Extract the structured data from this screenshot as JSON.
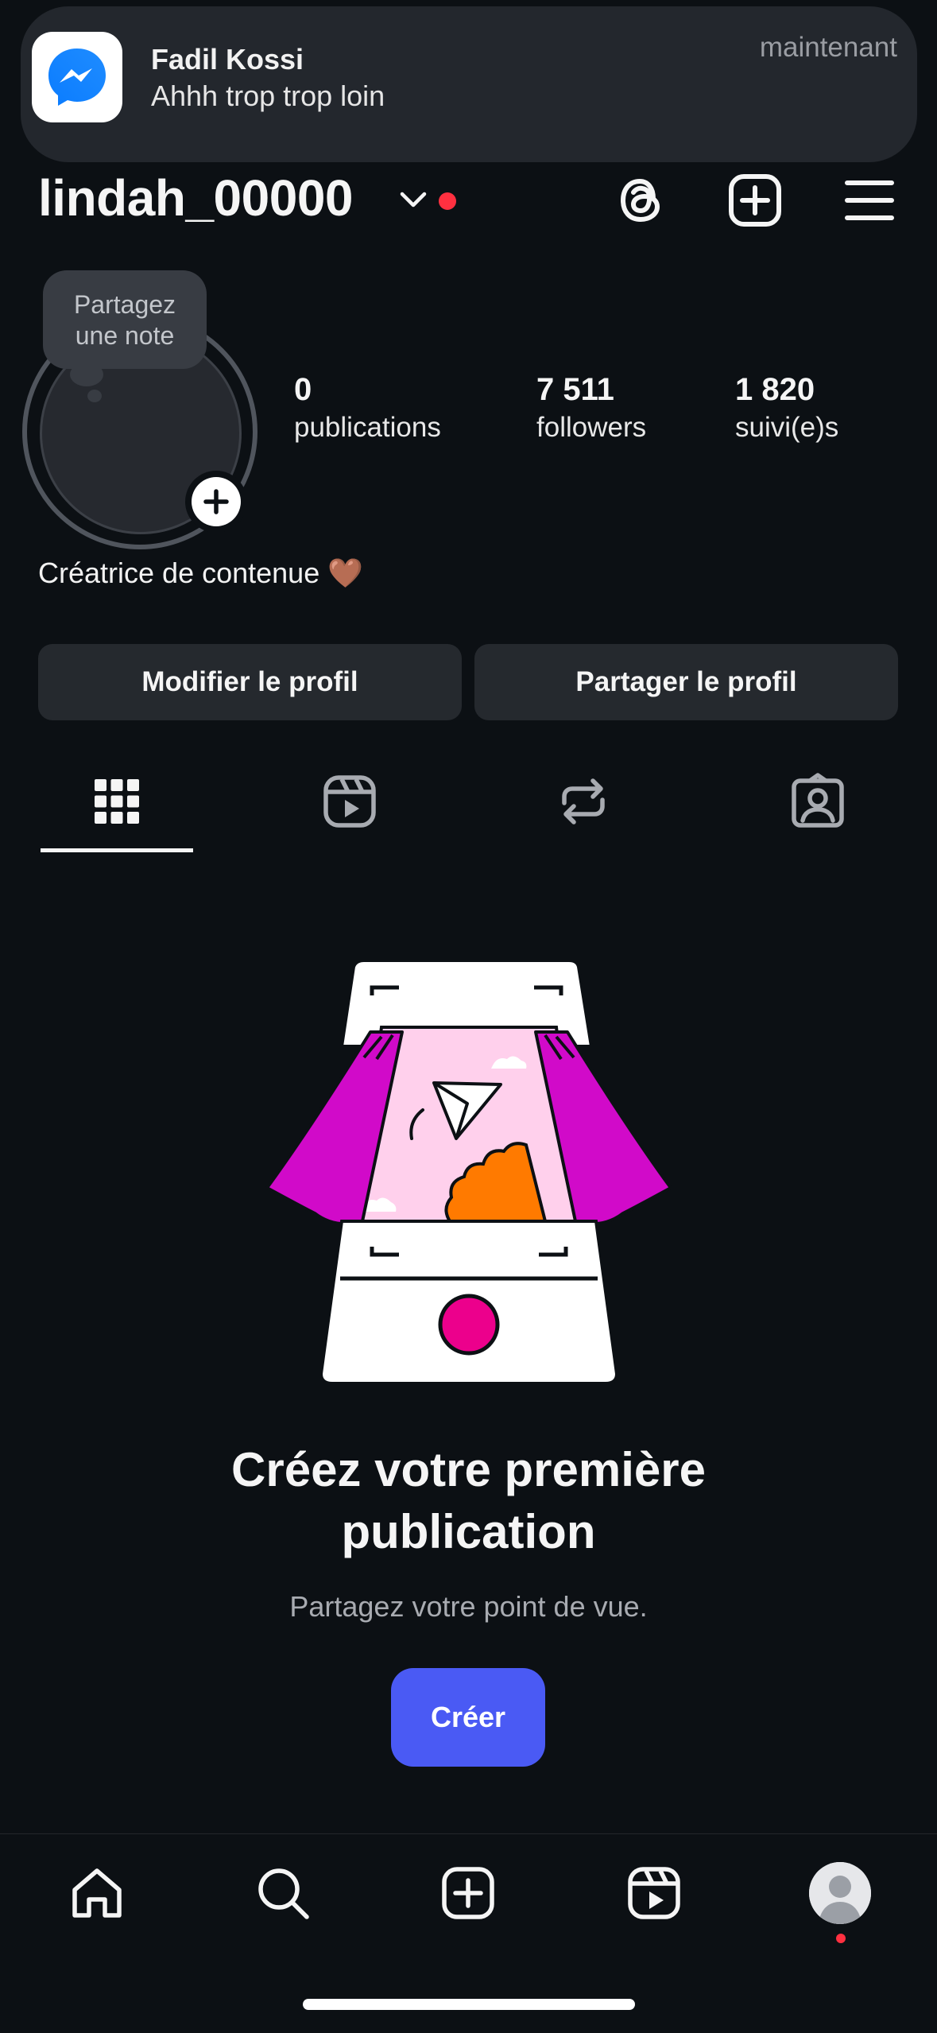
{
  "notification": {
    "app_icon": "messenger-icon",
    "sender": "Fadil Kossi",
    "message": "Ahhh trop trop loin",
    "time": "maintenant"
  },
  "header": {
    "username": "lindah_00000",
    "icons": [
      "chevron-down-icon",
      "threads-icon",
      "plus-square-icon",
      "menu-icon"
    ]
  },
  "profile": {
    "note_prompt_line1": "Partagez",
    "note_prompt_line2": "une note",
    "stats": [
      {
        "value": "0",
        "label": "publications"
      },
      {
        "value": "7 511",
        "label": "followers"
      },
      {
        "value": "1 820",
        "label": "suivi(e)s"
      }
    ],
    "bio": "Créatrice de contenue 🤎"
  },
  "actions": {
    "edit_label": "Modifier le profil",
    "share_label": "Partager le profil"
  },
  "tabs": [
    "grid-icon",
    "reels-icon",
    "reposts-icon",
    "tagged-icon"
  ],
  "empty_state": {
    "title_line1": "Créez votre première",
    "title_line2": "publication",
    "subtitle": "Partagez votre point de vue.",
    "button_label": "Créer"
  },
  "bottom_nav": [
    "home-icon",
    "search-icon",
    "create-icon",
    "reels-icon",
    "profile-avatar"
  ],
  "colors": {
    "background": "#0c1014",
    "accent_button": "#4a5af4",
    "notification_dot": "#ff3040",
    "illustration_magenta": "#d10ac9",
    "illustration_orange": "#ff7a00",
    "illustration_pink": "#ffd0ec",
    "record_button": "#ec008c"
  }
}
